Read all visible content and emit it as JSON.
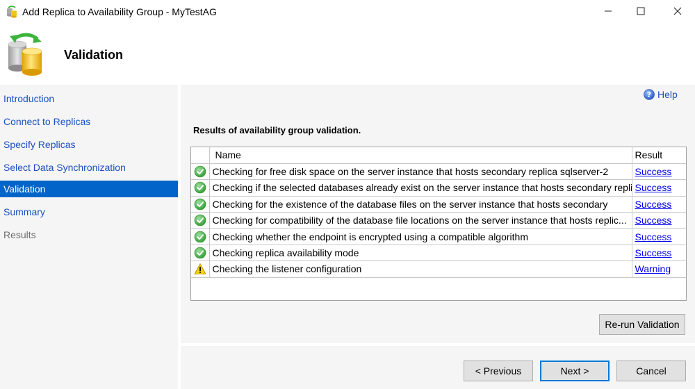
{
  "window": {
    "title": "Add Replica to Availability Group - MyTestAG",
    "controls": {
      "minimize": "minimize-icon",
      "maximize": "maximize-icon",
      "close": "close-icon"
    }
  },
  "header": {
    "title": "Validation",
    "icon": "database-replica-icon"
  },
  "nav": {
    "items": [
      {
        "label": "Introduction",
        "state": "link"
      },
      {
        "label": "Connect to Replicas",
        "state": "link"
      },
      {
        "label": "Specify Replicas",
        "state": "link"
      },
      {
        "label": "Select Data Synchronization",
        "state": "link"
      },
      {
        "label": "Validation",
        "state": "active"
      },
      {
        "label": "Summary",
        "state": "link"
      },
      {
        "label": "Results",
        "state": "disabled"
      }
    ]
  },
  "help": {
    "label": "Help",
    "icon": "help-icon"
  },
  "main": {
    "section_title": "Results of availability group validation.",
    "table": {
      "columns": [
        "",
        "Name",
        "Result"
      ],
      "rows": [
        {
          "status": "success",
          "name": "Checking for free disk space on the server instance that hosts secondary replica sqlserver-2",
          "result": "Success"
        },
        {
          "status": "success",
          "name": "Checking if the selected databases already exist on the server instance that hosts secondary repli...",
          "result": "Success"
        },
        {
          "status": "success",
          "name": "Checking for the existence of the database files on the server instance that hosts secondary",
          "result": "Success"
        },
        {
          "status": "success",
          "name": "Checking for compatibility of the database file locations on the server instance that hosts replic...",
          "result": "Success"
        },
        {
          "status": "success",
          "name": "Checking whether the endpoint is encrypted using a compatible algorithm",
          "result": "Success"
        },
        {
          "status": "success",
          "name": "Checking replica availability mode",
          "result": "Success"
        },
        {
          "status": "warning",
          "name": "Checking the listener configuration",
          "result": "Warning"
        }
      ]
    },
    "rerun_label": "Re-run Validation"
  },
  "footer": {
    "previous_label": "< Previous",
    "next_label": "Next >",
    "cancel_label": "Cancel"
  },
  "colors": {
    "nav_active_bg": "#0064c8",
    "nav_link": "#1a4ec2",
    "link": "#0000ee",
    "success_green": "#3aa53a",
    "warning_yellow": "#f5d400",
    "panel_bg": "#f5f5f5",
    "default_button_border": "#0078d7"
  }
}
